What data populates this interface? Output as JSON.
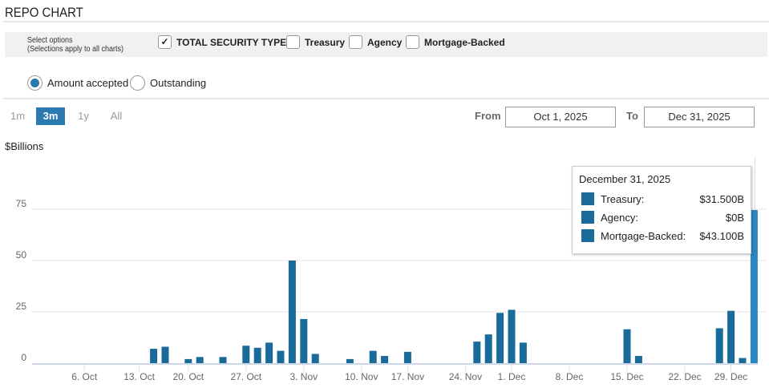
{
  "header": {
    "title": "REPO CHART"
  },
  "options": {
    "label_line1": "Select options",
    "label_line2": "(Selections apply to all charts)",
    "checkboxes": [
      {
        "label": "TOTAL SECURITY TYPES",
        "checked": true
      },
      {
        "label": "Treasury",
        "checked": false
      },
      {
        "label": "Agency",
        "checked": false
      },
      {
        "label": "Mortgage-Backed",
        "checked": false
      }
    ],
    "check_glyph": "✓"
  },
  "radios": [
    {
      "label": "Amount accepted",
      "selected": true
    },
    {
      "label": "Outstanding",
      "selected": false
    }
  ],
  "ranges": [
    {
      "label": "1m"
    },
    {
      "label": "3m",
      "active": true
    },
    {
      "label": "1y"
    },
    {
      "label": "All"
    }
  ],
  "date_range": {
    "from_label": "From",
    "from": "Oct 1, 2025",
    "to_label": "To",
    "to": "Dec 31, 2025"
  },
  "colors": {
    "bar": "#1a6a9a",
    "accent": "#2a7ab0",
    "hover_bar": "#2a86c0"
  },
  "tooltip": {
    "date": "December 31, 2025",
    "rows": [
      {
        "name": "Treasury:",
        "value": "$31.500B"
      },
      {
        "name": "Agency:",
        "value": "$0B"
      },
      {
        "name": "Mortgage-Backed:",
        "value": "$43.100B"
      }
    ]
  },
  "chart_data": {
    "type": "bar",
    "ylabel": "$Billions",
    "ylim": [
      0,
      80
    ],
    "yticks": [
      0,
      25,
      50,
      75
    ],
    "grid": true,
    "xrange": [
      "2025-10-01",
      "2025-12-31"
    ],
    "xticks": [
      {
        "date": "2025-10-06",
        "label": "6. Oct"
      },
      {
        "date": "2025-10-13",
        "label": "13. Oct"
      },
      {
        "date": "2025-10-20",
        "label": "20. Oct"
      },
      {
        "date": "2025-10-27",
        "label": "27. Oct"
      },
      {
        "date": "2025-11-03",
        "label": "3. Nov"
      },
      {
        "date": "2025-11-10",
        "label": "10. Nov"
      },
      {
        "date": "2025-11-17",
        "label": "17. Nov"
      },
      {
        "date": "2025-11-24",
        "label": "24. Nov"
      },
      {
        "date": "2025-12-01",
        "label": "1. Dec"
      },
      {
        "date": "2025-12-08",
        "label": "8. Dec"
      },
      {
        "date": "2025-12-15",
        "label": "15. Dec"
      },
      {
        "date": "2025-12-22",
        "label": "22. Dec"
      },
      {
        "date": "2025-12-29",
        "label": "29. Dec"
      }
    ],
    "bars": [
      {
        "date": "2025-10-15",
        "value": 7
      },
      {
        "date": "2025-10-16",
        "value": 8
      },
      {
        "date": "2025-10-20",
        "value": 2
      },
      {
        "date": "2025-10-21",
        "value": 3
      },
      {
        "date": "2025-10-23",
        "value": 3
      },
      {
        "date": "2025-10-27",
        "value": 8.5
      },
      {
        "date": "2025-10-28",
        "value": 7.5
      },
      {
        "date": "2025-10-29",
        "value": 10
      },
      {
        "date": "2025-10-30",
        "value": 6
      },
      {
        "date": "2025-10-31",
        "value": 50
      },
      {
        "date": "2025-11-03",
        "value": 21.5
      },
      {
        "date": "2025-11-04",
        "value": 4.5
      },
      {
        "date": "2025-11-07",
        "value": 2
      },
      {
        "date": "2025-11-12",
        "value": 6
      },
      {
        "date": "2025-11-13",
        "value": 3.5
      },
      {
        "date": "2025-11-17",
        "value": 5.5
      },
      {
        "date": "2025-11-25",
        "value": 10.5
      },
      {
        "date": "2025-11-26",
        "value": 14
      },
      {
        "date": "2025-11-28",
        "value": 24.5
      },
      {
        "date": "2025-12-01",
        "value": 26
      },
      {
        "date": "2025-12-02",
        "value": 10
      },
      {
        "date": "2025-12-15",
        "value": 16.5
      },
      {
        "date": "2025-12-16",
        "value": 3.5
      },
      {
        "date": "2025-12-26",
        "value": 17
      },
      {
        "date": "2025-12-29",
        "value": 25.5
      },
      {
        "date": "2025-12-30",
        "value": 2.5
      },
      {
        "date": "2025-12-31",
        "value": 74.6
      }
    ],
    "hovered": "2025-12-31"
  }
}
